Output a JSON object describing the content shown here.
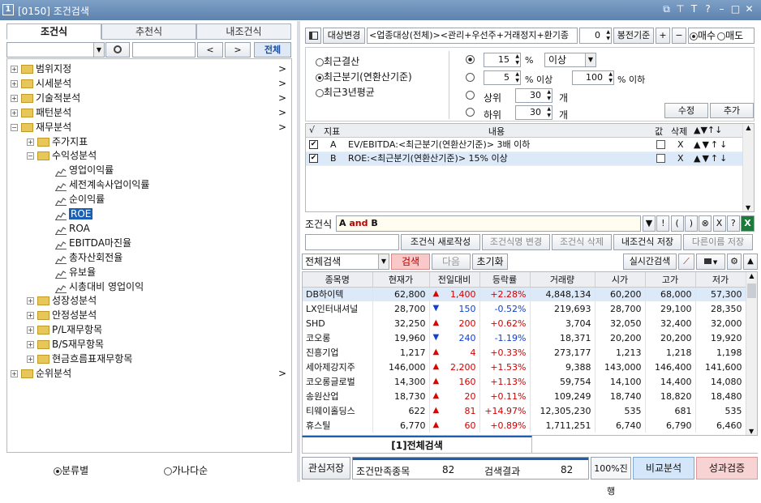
{
  "title": {
    "num": "1",
    "text": "[0150] 조건검색",
    "icons": [
      "restore-icon",
      "pin-icon",
      "font-icon",
      "help-icon",
      "minimize-icon",
      "maximize-icon",
      "close-icon"
    ],
    "glyphs": [
      "⧉",
      "⊤",
      "T",
      "?",
      "–",
      "□",
      "✕"
    ]
  },
  "left": {
    "tabs": [
      "조건식",
      "추천식",
      "내조건식"
    ],
    "search": {
      "placeholder": "",
      "prev": "<",
      "next": ">",
      "all": "전체"
    },
    "tree": [
      {
        "d": 0,
        "pm": "+",
        "t": "범위지정",
        "arrow": ">"
      },
      {
        "d": 0,
        "pm": "+",
        "t": "시세분석",
        "arrow": ">"
      },
      {
        "d": 0,
        "pm": "+",
        "t": "기술적분석",
        "arrow": ">"
      },
      {
        "d": 0,
        "pm": "+",
        "t": "패턴분석",
        "arrow": ">"
      },
      {
        "d": 0,
        "pm": "-",
        "t": "재무분석",
        "arrow": ">"
      },
      {
        "d": 1,
        "pm": "+",
        "t": "주가지표"
      },
      {
        "d": 1,
        "pm": "-",
        "t": "수익성분석"
      },
      {
        "d": 2,
        "leaf": 1,
        "t": "영업이익률"
      },
      {
        "d": 2,
        "leaf": 1,
        "t": "세전계속사업이익률"
      },
      {
        "d": 2,
        "leaf": 1,
        "t": "순이익률"
      },
      {
        "d": 2,
        "leaf": 1,
        "t": "ROE",
        "sel": 1
      },
      {
        "d": 2,
        "leaf": 1,
        "t": "ROA"
      },
      {
        "d": 2,
        "leaf": 1,
        "t": "EBITDA마진율"
      },
      {
        "d": 2,
        "leaf": 1,
        "t": "총자산회전율"
      },
      {
        "d": 2,
        "leaf": 1,
        "t": "유보율"
      },
      {
        "d": 2,
        "leaf": 1,
        "t": "시총대비 영업이익"
      },
      {
        "d": 1,
        "pm": "+",
        "t": "성장성분석"
      },
      {
        "d": 1,
        "pm": "+",
        "t": "안정성분석"
      },
      {
        "d": 1,
        "pm": "+",
        "t": "P/L재무항목"
      },
      {
        "d": 1,
        "pm": "+",
        "t": "B/S재무항목"
      },
      {
        "d": 1,
        "pm": "+",
        "t": "현금흐름표재무항목"
      },
      {
        "d": 0,
        "pm": "+",
        "t": "순위분석",
        "arrow": ">"
      }
    ],
    "radio1": "분류별",
    "radio2": "가나다순"
  },
  "right": {
    "top": {
      "target_btn": "대상변경",
      "target_text": "<업종대상(전체)><관리+우선주+거래정지+환기종",
      "num": "0",
      "mode": "봉전기준",
      "plus": "+",
      "minus": "−",
      "buy": "매수",
      "sell": "매도"
    },
    "opts": {
      "o1": "최근결산",
      "o2": "최근분기(연환산기준)",
      "o3": "최근3년평균",
      "r1_val": "15",
      "r1_unit": "%",
      "r1_sel": "이상",
      "r2_val": "5",
      "r2_unit": "% 이상",
      "r2_val2": "100",
      "r2_unit2": "% 이하",
      "top_label": "상위",
      "top_val": "30",
      "top_unit": "개",
      "bot_label": "하위",
      "bot_val": "30",
      "bot_unit": "개",
      "edit": "수정",
      "add": "추가"
    },
    "cond_header": [
      "√",
      "지표",
      "내용",
      "값",
      "삭제",
      "▲▼↑↓"
    ],
    "conds": [
      {
        "id": "A",
        "text": "EV/EBITDA:<최근분기(연환산기준)> 3배 이하",
        "del": "X",
        "arrows": "▲▼↑↓"
      },
      {
        "id": "B",
        "text": "ROE:<최근분기(연환산기준)> 15% 이상",
        "del": "X",
        "arrows": "▲▼↑↓"
      }
    ],
    "formula": {
      "label": "조건식",
      "a": "A",
      "and": "and",
      "b": "B",
      "btns": [
        "▼",
        "!",
        "(",
        ")",
        "⊗",
        "X",
        "?"
      ]
    },
    "actions": [
      "조건식 새로작성",
      "조건식명 변경",
      "조건식 삭제",
      "내조건식 저장",
      "다른이름 저장"
    ],
    "search_bar": {
      "scope": "전체검색",
      "search": "검색",
      "next": "다음",
      "reset": "초기화",
      "realtime": "실시간검색"
    },
    "columns": [
      "종목명",
      "현재가",
      "전일대비",
      "등락률",
      "거래량",
      "시가",
      "고가",
      "저가"
    ],
    "rows": [
      [
        "DB하이텍",
        "62,800",
        "▲",
        "1,400",
        "+2.28%",
        "4,848,134",
        "60,200",
        "68,000",
        "57,300"
      ],
      [
        "LX인터내셔널",
        "28,700",
        "▼",
        "150",
        "-0.52%",
        "219,693",
        "28,700",
        "29,100",
        "28,350"
      ],
      [
        "SHD",
        "32,250",
        "▲",
        "200",
        "+0.62%",
        "3,704",
        "32,050",
        "32,400",
        "32,000"
      ],
      [
        "코오롱",
        "19,960",
        "▼",
        "240",
        "-1.19%",
        "18,371",
        "20,200",
        "20,200",
        "19,920"
      ],
      [
        "진흥기업",
        "1,217",
        "▲",
        "4",
        "+0.33%",
        "273,177",
        "1,213",
        "1,218",
        "1,198"
      ],
      [
        "세아제강지주",
        "146,000",
        "▲",
        "2,200",
        "+1.53%",
        "9,388",
        "143,000",
        "146,400",
        "141,600"
      ],
      [
        "코오롱글로벌",
        "14,300",
        "▲",
        "160",
        "+1.13%",
        "59,754",
        "14,100",
        "14,400",
        "14,080"
      ],
      [
        "송원산업",
        "18,730",
        "▲",
        "20",
        "+0.11%",
        "109,249",
        "18,740",
        "18,820",
        "18,480"
      ],
      [
        "티웨이홀딩스",
        "622",
        "▲",
        "81",
        "+14.97%",
        "12,305,230",
        "535",
        "681",
        "535"
      ],
      [
        "휴스틸",
        "6,770",
        "▲",
        "60",
        "+0.89%",
        "1,711,251",
        "6,740",
        "6,790",
        "6,460"
      ]
    ],
    "bottom_tab": "[1]전체검색",
    "footer": {
      "save": "관심저장",
      "match_label": "조건만족종목",
      "match": "82",
      "result_label": "검색결과",
      "result": "82",
      "progress": "100%진행",
      "progress_value": 1.0,
      "compare": "비교분석",
      "verify": "성과검증"
    }
  },
  "colors": {
    "titlebar": "#6b8fb8",
    "accent": "#1a5fb4",
    "highlight": "#dce9f8",
    "red": "#d20000",
    "blue": "#1040d0"
  }
}
